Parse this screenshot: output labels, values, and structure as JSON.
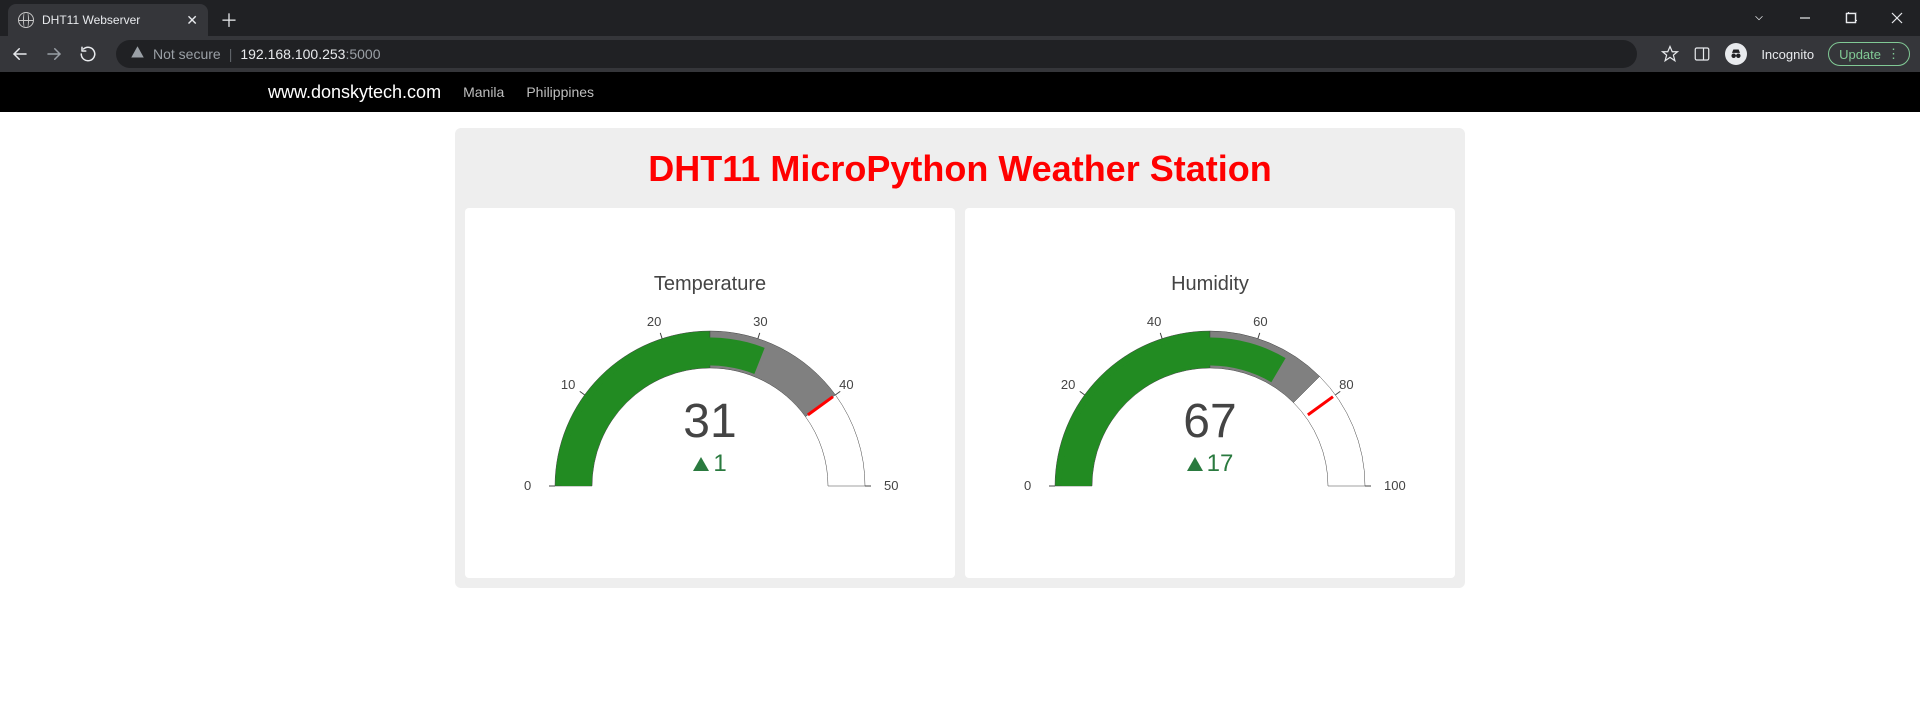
{
  "browser": {
    "tab_title": "DHT11 Webserver",
    "not_secure": "Not secure",
    "url_host": "192.168.100.253",
    "url_port": ":5000",
    "incognito": "Incognito",
    "update": "Update"
  },
  "nav": {
    "brand": "www.donskytech.com",
    "link1": "Manila",
    "link2": "Philippines"
  },
  "headline": "DHT11 MicroPython Weather Station",
  "chart_data": [
    {
      "type": "gauge",
      "title": "Temperature",
      "min": 0,
      "max": 50,
      "value": 31,
      "reference": 30,
      "delta": 1,
      "delta_direction": "up",
      "threshold": 40,
      "steps": [
        {
          "range": [
            0,
            25
          ],
          "color": "#228b22"
        },
        {
          "range": [
            25,
            40
          ],
          "color": "#808080"
        },
        {
          "range": [
            40,
            50
          ],
          "color": "#ffffff"
        }
      ],
      "bar_color": "#228b22",
      "ticks": [
        0,
        10,
        20,
        30,
        40,
        50
      ]
    },
    {
      "type": "gauge",
      "title": "Humidity",
      "min": 0,
      "max": 100,
      "value": 67,
      "reference": 50,
      "delta": 17,
      "delta_direction": "up",
      "threshold": 80,
      "steps": [
        {
          "range": [
            0,
            50
          ],
          "color": "#228b22"
        },
        {
          "range": [
            50,
            75
          ],
          "color": "#808080"
        },
        {
          "range": [
            75,
            100
          ],
          "color": "#ffffff"
        }
      ],
      "bar_color": "#228b22",
      "ticks": [
        0,
        20,
        40,
        60,
        80,
        100
      ]
    }
  ]
}
